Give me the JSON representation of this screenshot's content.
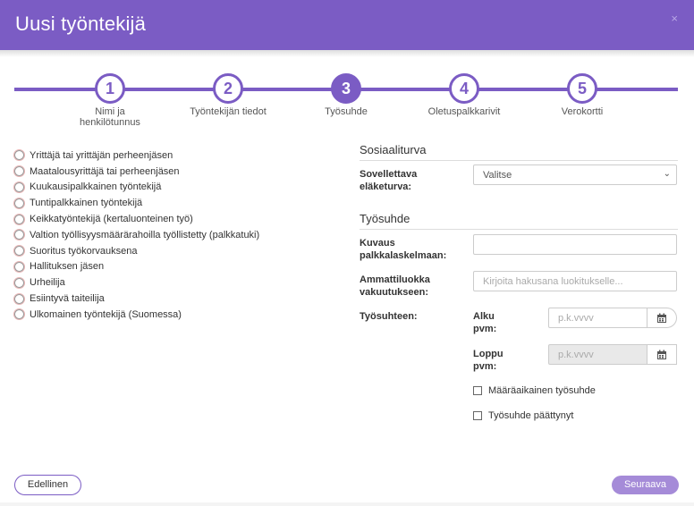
{
  "header": {
    "title": "Uusi työntekijä",
    "close": "×"
  },
  "stepper": {
    "steps": [
      {
        "number": "1",
        "label": "Nimi ja henkilötunnus",
        "active": false
      },
      {
        "number": "2",
        "label": "Työntekijän tiedot",
        "active": false
      },
      {
        "number": "3",
        "label": "Työsuhde",
        "active": true
      },
      {
        "number": "4",
        "label": "Oletuspalkkarivit",
        "active": false
      },
      {
        "number": "5",
        "label": "Verokortti",
        "active": false
      }
    ]
  },
  "employment_types": [
    "Yrittäjä tai yrittäjän perheenjäsen",
    "Maatalousyrittäjä tai perheenjäsen",
    "Kuukausipalkkainen työntekijä",
    "Tuntipalkkainen työntekijä",
    "Keikkatyöntekijä (kertaluonteinen työ)",
    "Valtion työllisyysmäärärahoilla työllistetty (palkkatuki)",
    "Suoritus työkorvauksena",
    "Hallituksen jäsen",
    "Urheilija",
    "Esiintyvä taiteilija",
    "Ulkomainen työntekijä (Suomessa)"
  ],
  "social_security": {
    "title": "Sosiaaliturva",
    "pension_label": "Sovellettava eläketurva:",
    "pension_value": "Valitse"
  },
  "employment": {
    "title": "Työsuhde",
    "pay_description_label": "Kuvaus palkkalaskelmaan:",
    "pay_description_value": "",
    "occupation_label": "Ammattiluokka vakuutukseen:",
    "occupation_placeholder": "Kirjoita hakusana luokitukselle...",
    "period_label": "Työsuhteen:",
    "start_label": "Alku pvm:",
    "start_placeholder": "p.k.vvvv",
    "end_label": "Loppu pvm:",
    "end_placeholder": "p.k.vvvv",
    "fixed_term_label": "Määräaikainen työsuhde",
    "ended_label": "Työsuhde päättynyt"
  },
  "footer": {
    "prev_label": "Edellinen",
    "next_label": "Seuraava"
  },
  "colors": {
    "accent": "#7b5cc4",
    "next_button": "#a58bd8"
  }
}
